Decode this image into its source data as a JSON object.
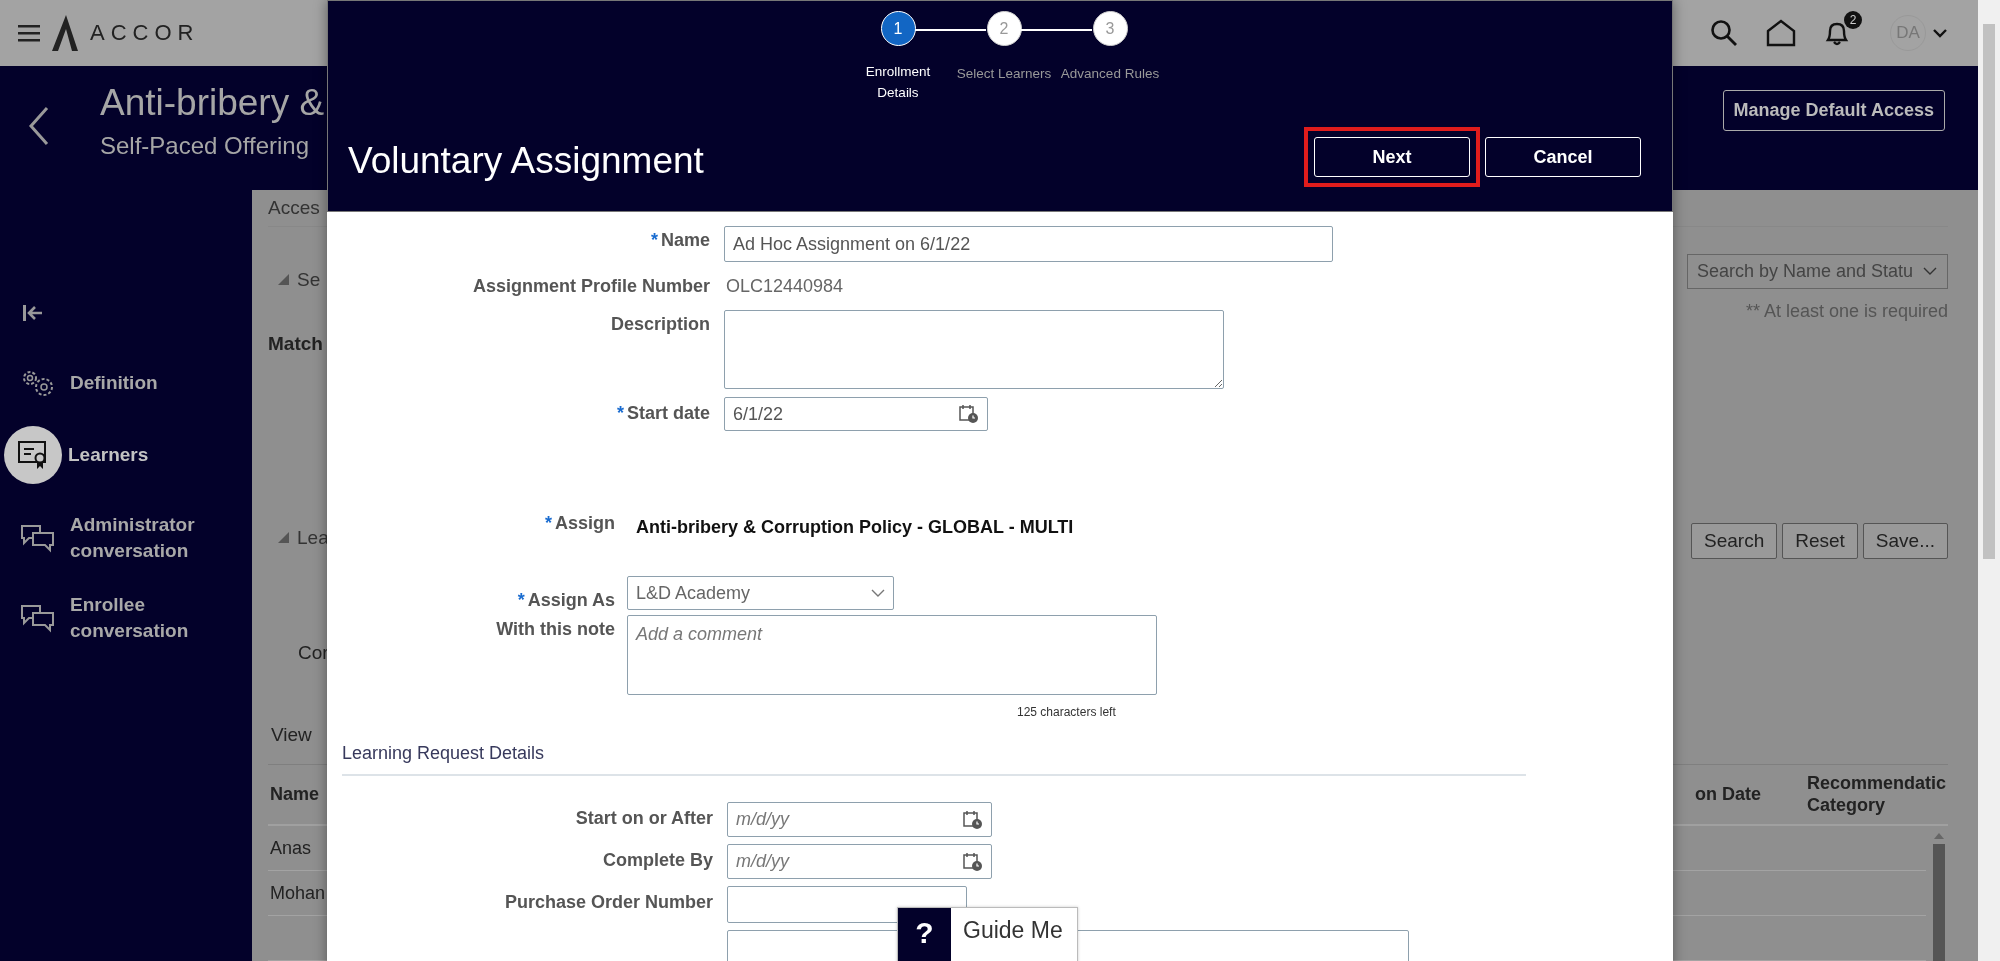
{
  "top_bar": {
    "logo": "ACCOR",
    "notification_count": "2",
    "avatar": "DA"
  },
  "header": {
    "title": "Anti-bribery &",
    "subtitle": "Self-Paced Offering",
    "action": "Manage Default Access"
  },
  "sidebar": {
    "items": [
      {
        "label": "Definition",
        "kind": "gears",
        "selected": false
      },
      {
        "label": "Learners",
        "kind": "certificate",
        "selected": true
      },
      {
        "label": "Administrator conversation",
        "kind": "chat",
        "selected": false
      },
      {
        "label": "Enrollee conversation",
        "kind": "chat",
        "selected": false
      }
    ]
  },
  "content": {
    "tab": "Acces",
    "section_1": "Se",
    "match_label": "Match",
    "section_2": "Lea",
    "criteria_label": "Cor",
    "view_label": "View",
    "search_select": "Search by Name and Statu",
    "required_note": "** At least one is required",
    "buttons": [
      "Search",
      "Reset",
      "Save..."
    ],
    "table": {
      "columns": [
        "Name",
        "on Date",
        "Recommendatic Category"
      ],
      "rows": [
        [
          "Anas"
        ],
        [
          "Mohan"
        ]
      ]
    }
  },
  "dialog": {
    "steps": [
      {
        "number": "1",
        "label": "Enrollment Details",
        "selected": true
      },
      {
        "number": "2",
        "label": "Select Learners",
        "selected": false
      },
      {
        "number": "3",
        "label": "Advanced Rules",
        "selected": false
      }
    ],
    "title": "Voluntary Assignment",
    "next_button": {
      "label": "Next",
      "highlighted": true
    },
    "cancel_button": "Cancel",
    "fields": {
      "name": {
        "mark": "*",
        "label": "Name",
        "value": "Ad Hoc Assignment on 6/1/22"
      },
      "profile_number": {
        "label": "Assignment Profile Number",
        "value": "OLC12440984"
      },
      "description": {
        "label": "Description"
      },
      "start_date": {
        "mark": "*",
        "label": "Start date",
        "value": "6/1/22"
      },
      "assign": {
        "mark": "*",
        "label": "Assign",
        "value": "Anti-bribery & Corruption Policy - GLOBAL - MULTI"
      },
      "assign_as": {
        "mark": "*",
        "label": "Assign As",
        "value": "L&D Academy"
      },
      "note": {
        "label": "With this note",
        "placeholder": "Add a comment",
        "counter": "125 characters left"
      }
    },
    "section_title": "Learning Request Details",
    "request_fields": [
      {
        "label": "Start on or After",
        "kind": "date",
        "placeholder": "m/d/yy"
      },
      {
        "label": "Complete By",
        "kind": "date",
        "placeholder": "m/d/yy"
      },
      {
        "label": "Purchase Order Number",
        "kind": "text"
      }
    ]
  },
  "guide": {
    "icon": "?",
    "label": "Guide Me"
  }
}
